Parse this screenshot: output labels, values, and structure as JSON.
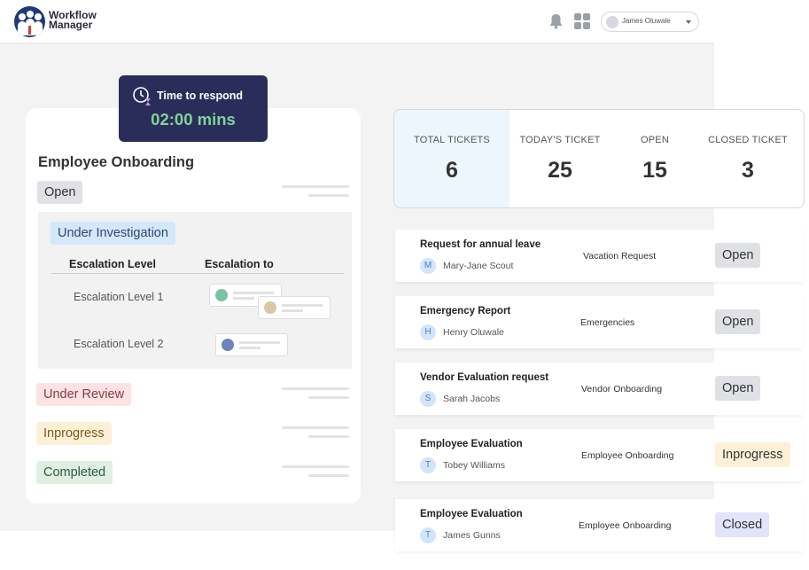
{
  "header": {
    "brand_line1": "Workflow",
    "brand_line2": "Manager",
    "user_name": "James Oluwale"
  },
  "timer": {
    "label": "Time to respond",
    "value": "02:00 mins"
  },
  "onboarding": {
    "title": "Employee Onboarding",
    "status_open": "Open",
    "status_investigation": "Under Investigation",
    "col_level": "Escalation Level",
    "col_to": "Escalation to",
    "level1": "Escalation Level 1",
    "level2": "Escalation Level 2",
    "status_review": "Under Review",
    "status_inprogress": "Inprogress",
    "status_completed": "Completed"
  },
  "stats": [
    {
      "label": "TOTAL TICKETS",
      "value": "6"
    },
    {
      "label": "TODAY'S TICKET",
      "value": "25"
    },
    {
      "label": "OPEN",
      "value": "15"
    },
    {
      "label": "CLOSED TICKET",
      "value": "3"
    }
  ],
  "tickets": [
    {
      "title": "Request for annual leave",
      "initial": "M",
      "name": "Mary-Jane Scout",
      "category": "Vacation Request",
      "status": "Open"
    },
    {
      "title": "Emergency Report",
      "initial": "H",
      "name": "Henry Oluwale",
      "category": "Emergencies",
      "status": "Open"
    },
    {
      "title": "Vendor Evaluation request",
      "initial": "S",
      "name": "Sarah Jacobs",
      "category": "Vendor Onboarding",
      "status": "Open"
    },
    {
      "title": "Employee Evaluation",
      "initial": "T",
      "name": "Tobey Williams",
      "category": "Employee Onboarding",
      "status": "Inprogress"
    },
    {
      "title": "Employee Evaluation",
      "initial": "T",
      "name": "James Gunns",
      "category": "Employee Onboarding",
      "status": "Closed"
    }
  ],
  "colors": {
    "brand_navy": "#2a2d5a",
    "timer_green": "#7ed49a",
    "open_gray": "#dfe1e4",
    "investigation_blue": "#d4e7fb",
    "review_red": "#fde3e3",
    "inprogress_yellow": "#fdf0d6",
    "completed_green": "#dff0e3",
    "closed_lavender": "#e3e3fb",
    "total_highlight": "#edf5fd"
  }
}
